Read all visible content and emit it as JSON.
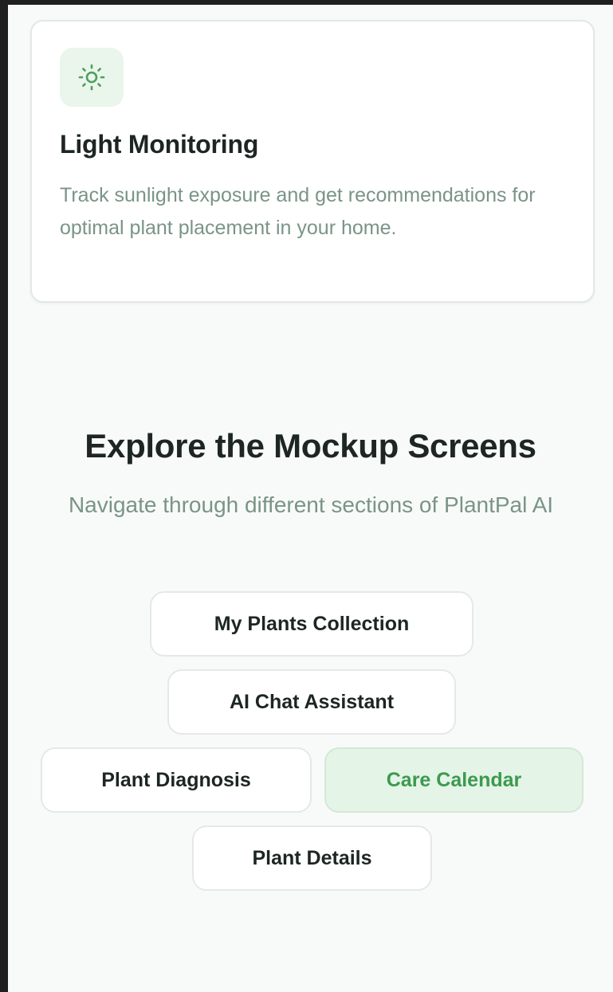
{
  "feature": {
    "icon": "sun-icon",
    "title": "Light Monitoring",
    "description": "Track sunlight exposure and get recommendations for optimal plant placement in your home."
  },
  "explore": {
    "title": "Explore the Mockup Screens",
    "subtitle": "Navigate through different sections of PlantPal AI",
    "buttons": [
      {
        "label": "My Plants Collection",
        "active": false
      },
      {
        "label": "AI Chat Assistant",
        "active": false
      },
      {
        "label": "Plant Diagnosis",
        "active": false
      },
      {
        "label": "Care Calendar",
        "active": true
      },
      {
        "label": "Plant Details",
        "active": false
      }
    ]
  },
  "colors": {
    "accent": "#3c9a4e",
    "accent_bg": "#e4f4e7",
    "muted_text": "#7a9487",
    "heading_text": "#1d2622"
  }
}
